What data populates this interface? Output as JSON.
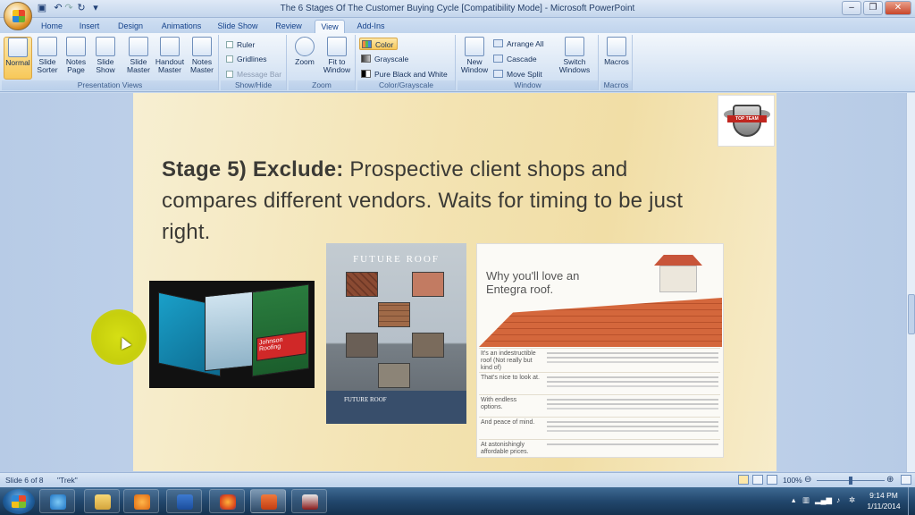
{
  "window": {
    "title": "The 6 Stages Of The Customer Buying Cycle [Compatibility Mode] - Microsoft PowerPoint",
    "controls": [
      "–",
      "❐",
      "✕"
    ]
  },
  "qat": [
    "save-icon",
    "undo-icon",
    "redo-icon",
    "customize-icon"
  ],
  "tabs": [
    "Home",
    "Insert",
    "Design",
    "Animations",
    "Slide Show",
    "Review",
    "View",
    "Add-Ins"
  ],
  "active_tab": "View",
  "ribbon": {
    "presentation_views": {
      "label": "Presentation Views",
      "buttons": [
        "Normal",
        "Slide Sorter",
        "Notes Page",
        "Slide Show",
        "Slide Master",
        "Handout Master",
        "Notes Master"
      ]
    },
    "show_hide": {
      "label": "Show/Hide",
      "ruler": "Ruler",
      "gridlines": "Gridlines",
      "message_bar": "Message Bar"
    },
    "zoom": {
      "label": "Zoom",
      "zoom": "Zoom",
      "fit": "Fit to Window"
    },
    "color": {
      "label": "Color/Grayscale",
      "color": "Color",
      "grayscale": "Grayscale",
      "pbw": "Pure Black and White"
    },
    "window": {
      "label": "Window",
      "new_window": "New Window",
      "arrange_all": "Arrange All",
      "cascade": "Cascade",
      "move_split": "Move Split",
      "switch_windows": "Switch Windows"
    },
    "macros": {
      "label": "Macros",
      "macros": "Macros"
    }
  },
  "slide": {
    "heading_bold": "Stage 5) Exclude:",
    "heading_rest": " Prospective client shops and compares different vendors. Waits for timing to be just right.",
    "logo": {
      "banner": "TOP TEAM"
    },
    "pic1": {
      "brochure_title": "Johnson Roofing"
    },
    "pic2": {
      "title": "FUTURE ROOF",
      "footer": "FUTURE ROOF"
    },
    "pic3": {
      "heading": "Why you'll love an Entegra roof.",
      "rows": [
        "It's an indestructible roof (Not really but kind of)",
        "That's nice to look at.",
        "With endless options.",
        "And peace of mind.",
        "At astonishingly affordable prices."
      ]
    }
  },
  "status": {
    "slide": "Slide 6 of 8",
    "theme": "\"Trek\"",
    "zoom": "100%"
  },
  "tray": {
    "time": "9:14 PM",
    "date": "1/11/2014"
  }
}
